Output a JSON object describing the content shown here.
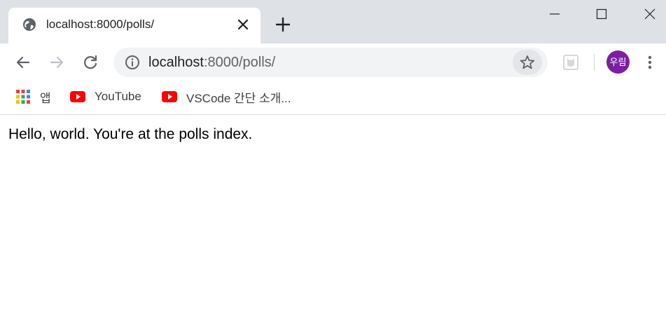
{
  "tab": {
    "title": "localhost:8000/polls/",
    "favicon": "globe-icon"
  },
  "window": {
    "controls": [
      "minimize",
      "maximize",
      "close"
    ]
  },
  "toolbar": {
    "url_host": "localhost",
    "url_rest": ":8000/polls/",
    "avatar_label": "우림",
    "avatar_color": "#7b1fa2"
  },
  "bookmarks": {
    "items": [
      {
        "label": "앱",
        "icon": "apps-grid-icon"
      },
      {
        "label": "YouTube",
        "icon": "youtube-icon"
      },
      {
        "label": "VSCode 간단 소개...",
        "icon": "youtube-icon"
      }
    ]
  },
  "page": {
    "text": "Hello, world. You're at the polls index."
  }
}
